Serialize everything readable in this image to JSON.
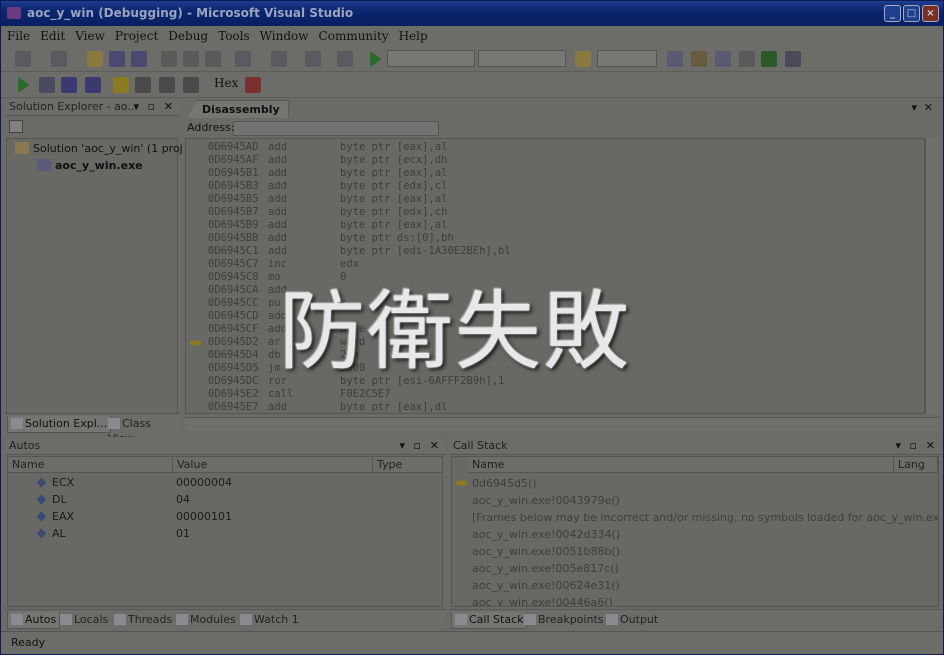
{
  "window": {
    "title": "aoc_y_win (Debugging) - Microsoft Visual Studio",
    "buttons": [
      "_",
      "□",
      "×"
    ]
  },
  "menu": [
    "File",
    "Edit",
    "View",
    "Project",
    "Debug",
    "Tools",
    "Window",
    "Community",
    "Help"
  ],
  "toolbar": {
    "hex_label": "Hex"
  },
  "solution_explorer": {
    "title": "Solution Explorer - ao...",
    "solution_item": "Solution 'aoc_y_win' (1 projec",
    "project_item": "aoc_y_win.exe",
    "tabs": [
      "Solution Expl...",
      "Class View"
    ]
  },
  "disassembly": {
    "tab": "Disassembly",
    "address_label": "Address:",
    "current_row": 15,
    "rows": [
      {
        "addr": "0D6945AD",
        "op": "add",
        "args": "byte ptr [eax],al"
      },
      {
        "addr": "0D6945AF",
        "op": "add",
        "args": "byte ptr [ecx],dh"
      },
      {
        "addr": "0D6945B1",
        "op": "add",
        "args": "byte ptr [eax],al"
      },
      {
        "addr": "0D6945B3",
        "op": "add",
        "args": "byte ptr [edx],cl"
      },
      {
        "addr": "0D6945B5",
        "op": "add",
        "args": "byte ptr [eax],al"
      },
      {
        "addr": "0D6945B7",
        "op": "add",
        "args": "byte ptr [edx],ch"
      },
      {
        "addr": "0D6945B9",
        "op": "add",
        "args": "byte ptr [eax],al"
      },
      {
        "addr": "0D6945BB",
        "op": "add",
        "args": "byte ptr ds:[0],bh"
      },
      {
        "addr": "0D6945C1",
        "op": "add",
        "args": "byte ptr [edi-1A30E2BEh],bl"
      },
      {
        "addr": "0D6945C7",
        "op": "inc",
        "args": "edx"
      },
      {
        "addr": "0D6945C8",
        "op": "mo",
        "args": "0"
      },
      {
        "addr": "0D6945CA",
        "op": "add",
        "args": ""
      },
      {
        "addr": "0D6945CC",
        "op": "pu",
        "args": "x"
      },
      {
        "addr": "0D6945CD",
        "op": "add",
        "args": ""
      },
      {
        "addr": "0D6945CF",
        "op": "add",
        "args": "byte"
      },
      {
        "addr": "0D6945D2",
        "op": "ar",
        "args": "word"
      },
      {
        "addr": "0D6945D4",
        "op": "db",
        "args": "22h"
      },
      {
        "addr": "0D6945D5",
        "op": "jm",
        "args": "3000"
      },
      {
        "addr": "0D6945DC",
        "op": "ror",
        "args": "byte ptr [esi-6AFFF2B9h],1"
      },
      {
        "addr": "0D6945E2",
        "op": "call",
        "args": "F0E2C5E7"
      },
      {
        "addr": "0D6945E7",
        "op": "add",
        "args": "byte ptr [eax],dl"
      }
    ]
  },
  "autos": {
    "title": "Autos",
    "columns": [
      "Name",
      "Value",
      "Type"
    ],
    "rows": [
      {
        "name": "ECX",
        "value": "00000004"
      },
      {
        "name": "DL",
        "value": "04"
      },
      {
        "name": "EAX",
        "value": "00000101"
      },
      {
        "name": "AL",
        "value": "01"
      }
    ],
    "tabs": [
      "Autos",
      "Locals",
      "Threads",
      "Modules",
      "Watch 1"
    ]
  },
  "call_stack": {
    "title": "Call Stack",
    "columns": [
      "Name",
      "Lang"
    ],
    "rows": [
      "0d6945d5()",
      "aoc_y_win.exe!0043979e()",
      "[Frames below may be incorrect and/or missing, no symbols loaded for aoc_y_win.exe]",
      "aoc_y_win.exe!0042d334()",
      "aoc_y_win.exe!0051b88b()",
      "aoc_y_win.exe!005e817c()",
      "aoc_y_win.exe!00624e31()",
      "aoc_y_win.exe!00446a6()"
    ],
    "tabs": [
      "Call Stack",
      "Breakpoints",
      "Output"
    ]
  },
  "status": "Ready",
  "overlay_text": "防衛失敗"
}
